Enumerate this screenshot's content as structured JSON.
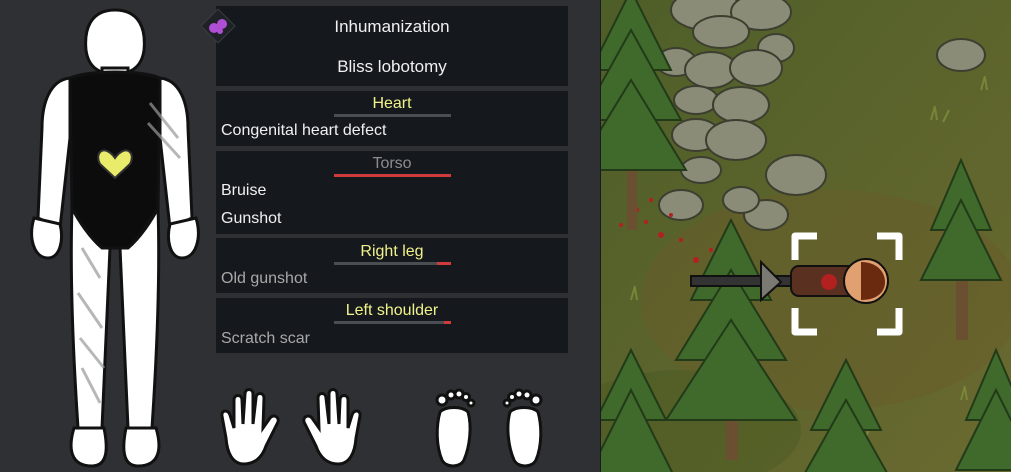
{
  "whole_body": {
    "icon": "implant-icon",
    "conditions": [
      "Inhumanization",
      "Bliss lobotomy"
    ]
  },
  "body_parts": [
    {
      "name": "Heart",
      "title_color": "#f2f28a",
      "damage": 0,
      "conditions": [
        {
          "label": "Congenital heart defect",
          "active": true
        }
      ]
    },
    {
      "name": "Torso",
      "title_color": "#8c8c8c",
      "damage": 1,
      "conditions": [
        {
          "label": "Bruise",
          "active": true
        },
        {
          "label": "Gunshot",
          "active": true
        }
      ]
    },
    {
      "name": "Right leg",
      "title_color": "#f2f28a",
      "damage": 0.12,
      "conditions": [
        {
          "label": "Old gunshot",
          "active": false
        }
      ]
    },
    {
      "name": "Left shoulder",
      "title_color": "#f2f28a",
      "damage": 0.06,
      "conditions": [
        {
          "label": "Scratch scar",
          "active": false
        }
      ]
    }
  ],
  "colors": {
    "panel_bg": "#15191e",
    "damage_bar": "#d13a3a",
    "heart_highlight": "#e9ec6a",
    "blood": "#b32020",
    "grass": "#596b2e"
  }
}
